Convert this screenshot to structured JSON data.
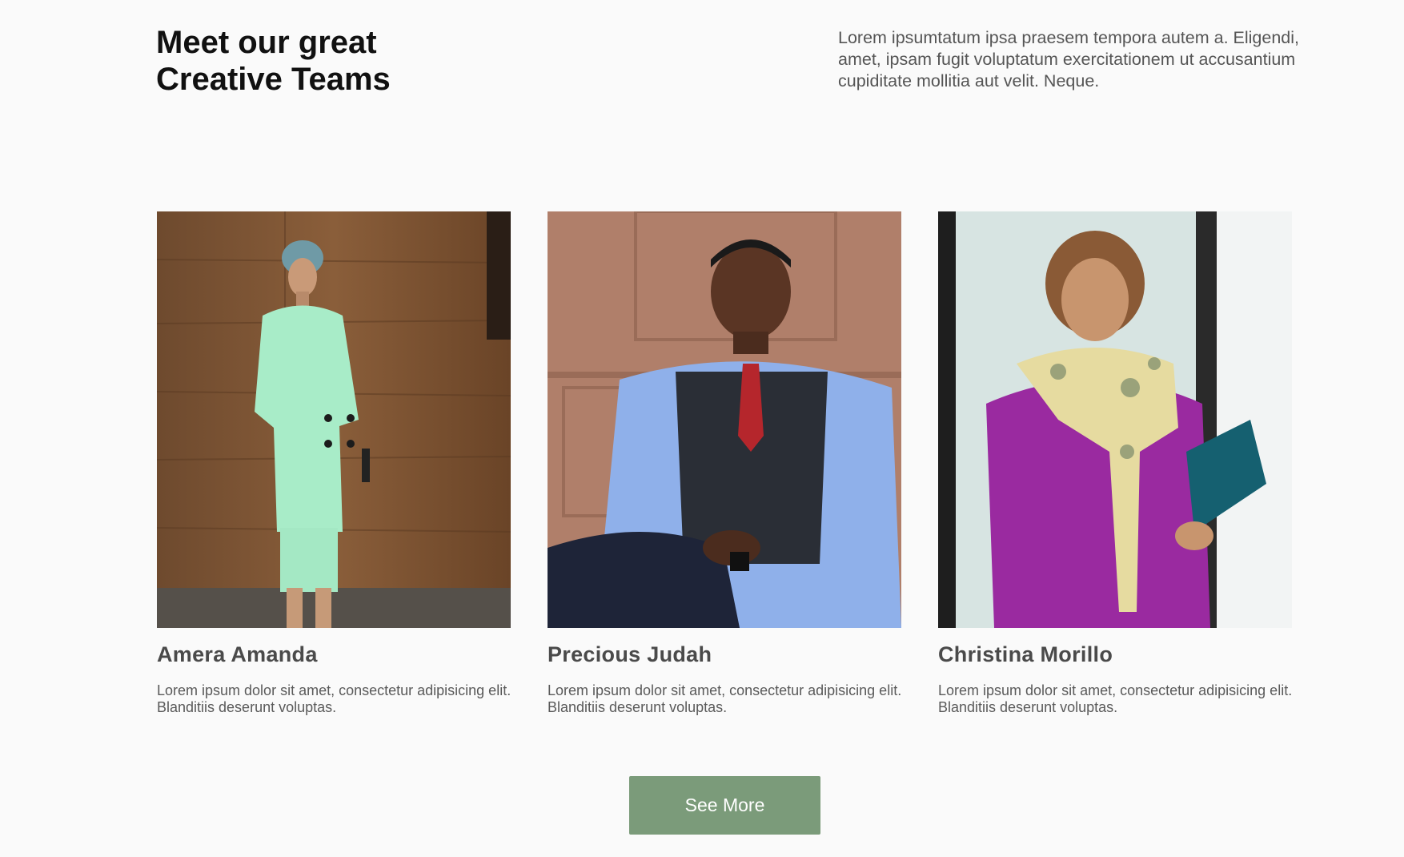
{
  "section": {
    "title_line1": "Meet our great",
    "title_line2": "Creative Teams",
    "intro": "Lorem ipsumtatum ipsa praesem tempora autem a. Eligendi, amet, ipsam fugit voluptatum exercitationem ut accusantium cupiditate mollitia aut velit. Neque."
  },
  "team": [
    {
      "name": "Amera Amanda",
      "bio": "Lorem ipsum dolor sit amet, consectetur adipisicing elit. Blanditiis deserunt voluptas."
    },
    {
      "name": "Precious Judah",
      "bio": "Lorem ipsum dolor sit amet, consectetur adipisicing elit. Blanditiis deserunt voluptas."
    },
    {
      "name": "Christina Morillo",
      "bio": "Lorem ipsum dolor sit amet, consectetur adipisicing elit. Blanditiis deserunt voluptas."
    }
  ],
  "cta": {
    "label": "See More"
  },
  "colors": {
    "background": "#fafafa",
    "button": "#7b9b7a",
    "heading": "#111111",
    "text": "#555555"
  }
}
